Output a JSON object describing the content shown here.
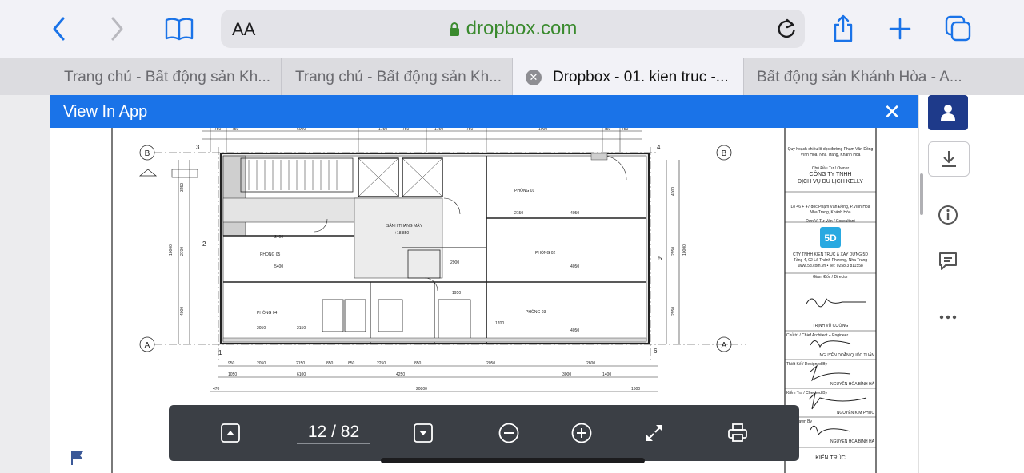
{
  "browser": {
    "aa_label": "AA",
    "domain": "dropbox.com",
    "tabs": [
      {
        "title": "Trang chủ - Bất động sản Kh..."
      },
      {
        "title": "Trang chủ - Bất động sản Kh..."
      },
      {
        "title": "Dropbox - 01. kien truc -..."
      },
      {
        "title": "Bất động sản Khánh Hòa - A..."
      }
    ]
  },
  "banner": {
    "text": "View In App"
  },
  "drawing": {
    "rooms": [
      "PHÒNG 01",
      "PHÒNG 02",
      "PHÒNG 03",
      "PHÒNG 04",
      "PHÒNG 05",
      "SẢNH THANG MÁY"
    ],
    "grid_labels": [
      "A",
      "B",
      "1",
      "2",
      "3",
      "4",
      "5",
      "6"
    ],
    "dims_top": [
      "750",
      "750",
      "6000",
      "1750",
      "750",
      "1750",
      "750",
      "1000",
      "750",
      "750"
    ],
    "dims_bottom_1": [
      "950",
      "2050",
      "2150",
      "850",
      "850",
      "2250",
      "850",
      "2050",
      "2800"
    ],
    "dims_bottom_2": [
      "1050",
      "6100",
      "4250",
      "3000",
      "1400"
    ],
    "dims_bottom_3": [
      "470",
      "20800",
      "1600"
    ],
    "dims_left": [
      "3250",
      "2700",
      "10000",
      "4000"
    ],
    "dims_right": [
      "4000",
      "2950",
      "10000",
      "2950"
    ],
    "interior_dims": [
      "3400",
      "5400",
      "2150",
      "4050",
      "2900",
      "4050",
      "2050",
      "2150",
      "1950",
      "1700",
      "4050"
    ],
    "level_mark": "+18,850"
  },
  "title_block": {
    "project": "Quy hoạch chiều lô dọc đường Phạm Văn Đồng\nVĩnh Hòa, Nha Trang, Khánh Hòa",
    "owner_label": "Chủ Đầu Tư / Owner",
    "company_1": "CÔNG TY TNHH",
    "company_2": "DỊCH VỤ DU LỊCH KELLY",
    "address": "Lô 46 + 47 dọc Phạm Văn Đồng, P.Vĩnh Hòa\nNha Trang, Khánh Hòa",
    "consultant_label": "Đơn Vị Tư Vấn / Consultant",
    "logo_text": "5D",
    "consultant_info": "CTY TNHH KIẾN TRÚC & XÂY DỰNG 5D\nTầng 4, 02 Lê Thánh Phương, Nha Trang\nwww.5d.com.vn • Tel: 0258 3 811558",
    "director_label": "Giám Đốc / Director",
    "director_name": "TRỊNH VŨ CƯỜNG",
    "chief_label": "Chủ trì / Chief Architect + Engineer",
    "chief_name": "NGUYỄN DOÃN QUỐC TUẤN",
    "designer_label": "Thiết Kế / Designed By",
    "designer_name": "NGUYỄN HÒA BÌNH HÀ",
    "checker_label": "Kiểm Tra / Checked By",
    "checker_name": "NGUYỄN KIM PHÚC",
    "drawn_label": "Vẽ / Drawn By",
    "drawn_name": "NGUYỄN HÒA BÌNH HÀ",
    "discipline": "KIẾN TRÚC"
  },
  "viewer": {
    "current_page": "12",
    "separator": "/",
    "total_pages": "82"
  },
  "icons": {
    "back": "chevron-left-icon",
    "forward": "chevron-right-icon",
    "bookmarks": "book-icon",
    "lock": "lock-icon",
    "reload": "reload-icon",
    "share": "share-icon",
    "new_tab": "plus-icon",
    "tabs": "tabs-icon"
  },
  "colors": {
    "accent": "#1a73e8",
    "domain_green": "#3a8a2e",
    "toolbar_bg": "#3b3f45",
    "account_btn": "#1e3a8a"
  }
}
